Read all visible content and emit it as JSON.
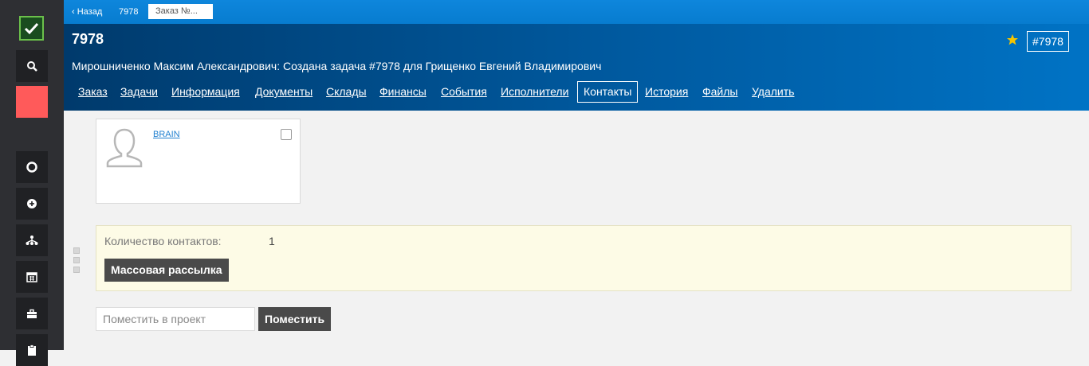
{
  "sidebar": {
    "icons": [
      "check-logo",
      "search-icon",
      "red-square",
      "lifebuoy-icon",
      "plus-circle-icon",
      "sitemap-icon",
      "calendar-icon",
      "briefcase-icon",
      "clipboard-icon"
    ]
  },
  "breadcrumbs": {
    "back": "‹ Назад",
    "item": "7978",
    "current": "Заказ №..."
  },
  "header": {
    "title": "7978",
    "subtitle": "Мирошниченко Максим Александрович: Создана задача #7978 для Грищенко Евгений Владимирович",
    "badge": "#7978"
  },
  "tabs": [
    {
      "label": "Заказ"
    },
    {
      "label": "Задачи"
    },
    {
      "label": "Информация"
    },
    {
      "label": "Документы"
    },
    {
      "label": "Склады"
    },
    {
      "label": "Финансы"
    },
    {
      "label": "События"
    },
    {
      "label": "Исполнители"
    },
    {
      "label": "Контакты",
      "active": true
    },
    {
      "label": "История"
    },
    {
      "label": "Файлы"
    },
    {
      "label": "Удалить"
    }
  ],
  "contact_card": {
    "name": "BRAIN"
  },
  "summary": {
    "count_label": "Количество контактов:",
    "count_value": "1",
    "mass_button": "Массовая рассылка"
  },
  "project": {
    "placeholder": "Поместить в проект",
    "button": "Поместить"
  },
  "colors": {
    "accent": "#0a7fd6",
    "header_dark": "#003a6c",
    "sidebar": "#2e2f33",
    "danger": "#ff5a5a",
    "star": "#f5c400"
  }
}
